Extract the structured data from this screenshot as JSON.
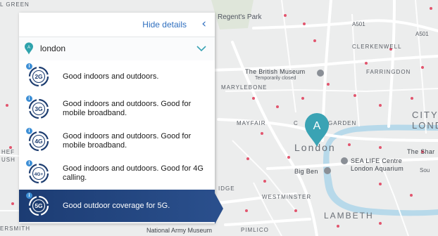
{
  "panel": {
    "hide_details": "Hide details",
    "location": "london",
    "technologies": [
      {
        "badge": "2G",
        "description": "Good indoors and outdoors."
      },
      {
        "badge": "3G",
        "description": "Good indoors and outdoors. Good for mobile broadband."
      },
      {
        "badge": "4G",
        "description": "Good indoors and outdoors. Good for mobile broadband."
      },
      {
        "badge": "4G+",
        "description": "Good indoors and outdoors. Good for 4G calling."
      },
      {
        "badge": "5G",
        "description": "Good outdoor coverage for 5G."
      }
    ],
    "selected_index": 4
  },
  "map": {
    "marker_letter": "A",
    "labels": {
      "regents_park": "Regent's Park",
      "clerkenwell": "CLERKENWELL",
      "farringdon": "FARRINGDON",
      "british_museum": "The British Museum",
      "temporarily_closed": "Temporarily closed",
      "marylebone": "MARYLEBONE",
      "mayfair": "MAYFAIR",
      "covent_garden": "GARDEN",
      "covent_c": "C",
      "city": "CITY",
      "lond": "LOND",
      "london": "London",
      "the_shard": "The Shar",
      "sea_life_1": "SEA LIFE Centre",
      "sea_life_2": "London Aquarium",
      "big_ben": "Big Ben",
      "westminster": "WESTMINSTER",
      "lambeth": "LAMBETH",
      "pimlico": "PIMLICO",
      "national_army_museum": "National Army Museum",
      "ersmith": "ERSMITH",
      "green": "L GREEN",
      "hef": "HEF",
      "ush": "USH",
      "idge": "IDGE",
      "sou": "Sou",
      "a501": "A501",
      "a501b": "A501",
      "a5": "A5"
    }
  },
  "colors": {
    "accent": "#2f6fbf",
    "selected_row": "#1f3f75",
    "marker": "#3aa3b4",
    "river": "#a9d3e6",
    "pin": "#2fa3ac"
  }
}
